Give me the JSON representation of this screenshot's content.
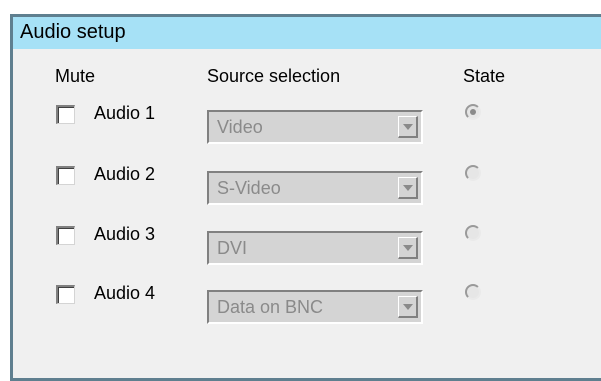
{
  "panel": {
    "title": "Audio setup"
  },
  "headers": {
    "mute": "Mute",
    "source": "Source selection",
    "state": "State"
  },
  "rows": [
    {
      "label": "Audio 1",
      "muted": false,
      "source": "Video",
      "state_selected": true
    },
    {
      "label": "Audio 2",
      "muted": false,
      "source": "S-Video",
      "state_selected": false
    },
    {
      "label": "Audio 3",
      "muted": false,
      "source": "DVI",
      "state_selected": false
    },
    {
      "label": "Audio 4",
      "muted": false,
      "source": "Data on BNC",
      "state_selected": false
    }
  ],
  "colors": {
    "titlebar": "#a6e1f6",
    "panel_bg": "#f0f0f0",
    "border": "#5f7f8f",
    "disabled_text": "#8a8a8a"
  },
  "icons": {
    "dropdown": "chevron-down-icon"
  }
}
